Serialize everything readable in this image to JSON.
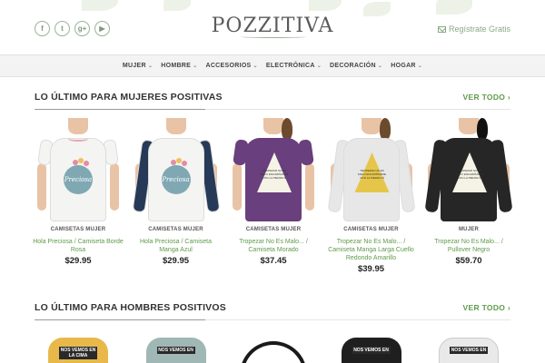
{
  "header": {
    "logo": "POZZITIVA",
    "signup": "Regístrate Gratis",
    "social": [
      {
        "icon": "facebook-icon",
        "glyph": "f"
      },
      {
        "icon": "twitter-icon",
        "glyph": "t"
      },
      {
        "icon": "google-plus-icon",
        "glyph": "g+"
      },
      {
        "icon": "youtube-icon",
        "glyph": "▶"
      }
    ]
  },
  "nav": [
    "MUJER",
    "HOMBRE",
    "ACCESORIOS",
    "ELECTRÓNICA",
    "DECORACIÓN",
    "HOGAR"
  ],
  "sections": [
    {
      "title": "LO ÚLTIMO PARA MUJERES POSITIVAS",
      "see_all": "VER TODO",
      "products": [
        {
          "category": "CAMISETAS MUJER",
          "name": "Hola Preciosa / Camiseta Borde Rosa",
          "price": "$29.95",
          "shirt_color": "#f4f4f2",
          "sleeve_color": "#f4f4f2",
          "print": "circle",
          "print_text": "Preciosa"
        },
        {
          "category": "CAMISETAS MUJER",
          "name": "Hola Preciosa / Camiseta Manga Azul",
          "price": "$29.95",
          "shirt_color": "#f4f4f2",
          "sleeve_color": "#263957",
          "print": "circle",
          "print_text": "Preciosa"
        },
        {
          "category": "CAMISETAS MUJER",
          "name": "Tropezar No Es Malo... / Camiseta Morado",
          "price": "$37.45",
          "shirt_color": "#6a3f7d",
          "sleeve_color": "#6a3f7d",
          "print": "triangle",
          "print_text": "TROPEZAR NO ES MALO ENCARIÑARSE CON LA PIEDRA SÍ"
        },
        {
          "category": "CAMISETAS MUJER",
          "name": "Tropezar No Es Malo... / Camiseta Manga Larga Cuello Redondo Amarillo",
          "price": "$39.95",
          "shirt_color": "#e7e7e7",
          "sleeve_color": "#e7e7e7",
          "print": "triangle-yellow",
          "print_text": "TROPEZAR NO ES MALO ENCARIÑARSE CON LA PIEDRA SÍ"
        },
        {
          "category": "MUJER",
          "name": "Tropezar No Es Malo... / Pullover Negro",
          "price": "$59.70",
          "shirt_color": "#262626",
          "sleeve_color": "#262626",
          "print": "triangle",
          "print_text": "TROPEZAR NO ES MALO ENCARIÑARSE CON LA PIEDRA SÍ"
        }
      ]
    },
    {
      "title": "LO ÚLTIMO PARA HOMBRES POSITIVOS",
      "see_all": "VER TODO",
      "products": [
        {
          "shirt_color": "#e8b84a",
          "label": "NOS VEMOS EN LA CIMA"
        },
        {
          "shirt_color": "#9fb7b5",
          "label": "NOS VEMOS EN"
        },
        {
          "shirt_color": "#ffffff",
          "label": ""
        },
        {
          "shirt_color": "#1f1f1f",
          "label": "NOS VEMOS EN"
        },
        {
          "shirt_color": "#e9e9e9",
          "label": "NOS VEMOS EN"
        }
      ]
    }
  ]
}
